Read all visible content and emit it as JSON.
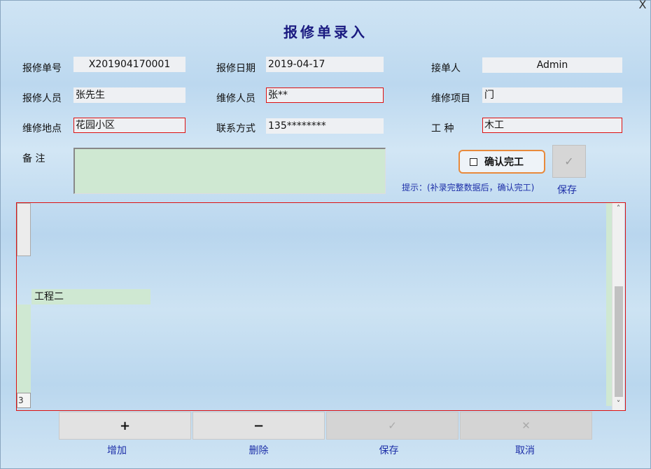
{
  "window": {
    "close_glyph": "X"
  },
  "title": "报修单录入",
  "form": {
    "order_no": {
      "label": "报修单号",
      "value": "X201904170001"
    },
    "report_date": {
      "label": "报修日期",
      "value": "2019-04-17"
    },
    "receiver": {
      "label": "接单人",
      "value": "Admin"
    },
    "reporter": {
      "label": "报修人员",
      "value": "张先生"
    },
    "repairer": {
      "label": "维修人员",
      "value": "张**"
    },
    "repair_item": {
      "label": "维修项目",
      "value": "门"
    },
    "location": {
      "label": "维修地点",
      "value": "花园小区"
    },
    "contact": {
      "label": "联系方式",
      "value": "135********"
    },
    "trade": {
      "label": "工 种",
      "value": "木工"
    },
    "notes": {
      "label": "备 注",
      "value": ""
    }
  },
  "confirm": {
    "label": "确认完工",
    "checked": false
  },
  "hint": "提示：(补录完整数据后，确认完工)",
  "top_save": {
    "label": "保存",
    "glyph": "✓"
  },
  "grid": {
    "cell_text": "工程二",
    "row_count": "3",
    "scroll_up": "˄",
    "scroll_down": "˅"
  },
  "bottom_buttons": [
    {
      "glyph": "+",
      "label": "增加",
      "enabled": true
    },
    {
      "glyph": "−",
      "label": "删除",
      "enabled": true
    },
    {
      "glyph": "✓",
      "label": "保存",
      "enabled": false
    },
    {
      "glyph": "✕",
      "label": "取消",
      "enabled": false
    }
  ],
  "colors": {
    "required_border": "#dd1111",
    "label_blue": "#1d2fa8",
    "title_navy": "#1a1a80",
    "note_bg": "#cfe8d2",
    "confirm_border": "#e88a3c"
  }
}
